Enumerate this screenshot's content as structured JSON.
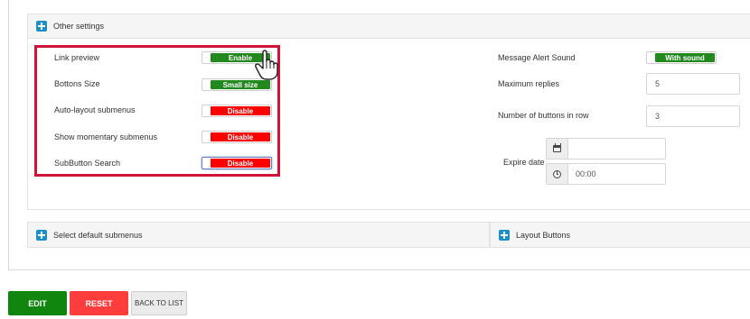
{
  "other_settings": {
    "title": "Other settings",
    "left_rows": [
      {
        "label": "Link preview",
        "toggle": "Enable",
        "color": "#21891e"
      },
      {
        "label": "Bottons Size",
        "toggle": "Small size",
        "color": "#21891e"
      },
      {
        "label": "Auto-layout submenus",
        "toggle": "Disable",
        "color": "#ff0000"
      },
      {
        "label": "Show momentary submenus",
        "toggle": "Disable",
        "color": "#ff0000"
      },
      {
        "label": "SubButton Search",
        "toggle": "Disable",
        "color": "#ff0000"
      }
    ],
    "message_alert_sound": {
      "label": "Message Alert Sound",
      "toggle": "With sound"
    },
    "maximum_replies": {
      "label": "Maximum replies",
      "value": "5"
    },
    "buttons_in_row": {
      "label": "Number of buttons in row",
      "value": "3"
    },
    "expire_date": {
      "label": "Expire date",
      "date_value": "",
      "time_value": "00:00"
    }
  },
  "collapsed_sections": {
    "select_default_submenus": "Select default submenus",
    "layout_buttons": "Layout Buttons"
  },
  "actions": {
    "edit": "EDIT",
    "reset": "RESET",
    "back_to_list": "BACK TO LIST"
  },
  "colors": {
    "accent_green": "#21891e",
    "disable_red": "#ff0000",
    "highlight": "#d1133a",
    "info_blue": "#1a8fc9"
  }
}
